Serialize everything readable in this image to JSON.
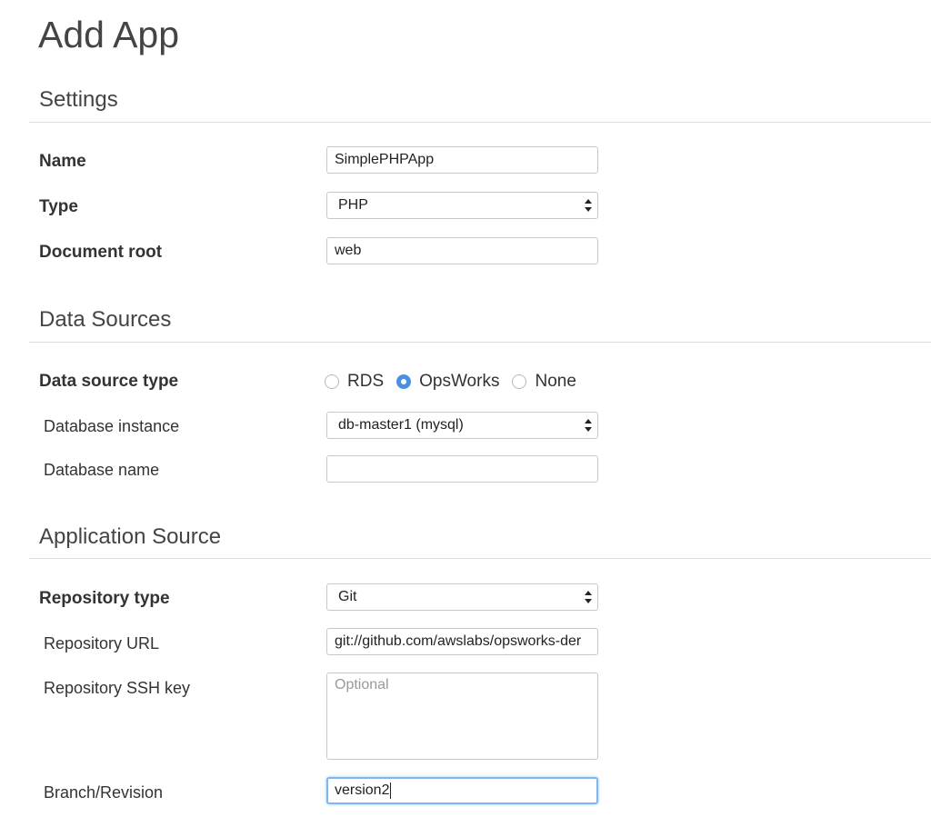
{
  "page": {
    "title": "Add App"
  },
  "settings": {
    "heading": "Settings",
    "name": {
      "label": "Name",
      "value": "SimplePHPApp"
    },
    "type": {
      "label": "Type",
      "value": "PHP"
    },
    "document_root": {
      "label": "Document root",
      "value": "web"
    }
  },
  "data_sources": {
    "heading": "Data Sources",
    "type_label": "Data source type",
    "options": [
      {
        "label": "RDS",
        "selected": false
      },
      {
        "label": "OpsWorks",
        "selected": true
      },
      {
        "label": "None",
        "selected": false
      }
    ],
    "database_instance": {
      "label": "Database instance",
      "value": "db-master1 (mysql)"
    },
    "database_name": {
      "label": "Database name",
      "value": ""
    }
  },
  "application_source": {
    "heading": "Application Source",
    "repository_type": {
      "label": "Repository type",
      "value": "Git"
    },
    "repository_url": {
      "label": "Repository URL",
      "value": "git://github.com/awslabs/opsworks-der"
    },
    "ssh_key": {
      "label": "Repository SSH key",
      "placeholder": "Optional"
    },
    "branch": {
      "label": "Branch/Revision",
      "value": "version2"
    }
  },
  "colors": {
    "accent": "#4a90e2",
    "focus_ring": "#7fb6ef",
    "divider": "#dcdcdc"
  },
  "icons": {
    "select_arrows": "select-arrows-icon"
  }
}
